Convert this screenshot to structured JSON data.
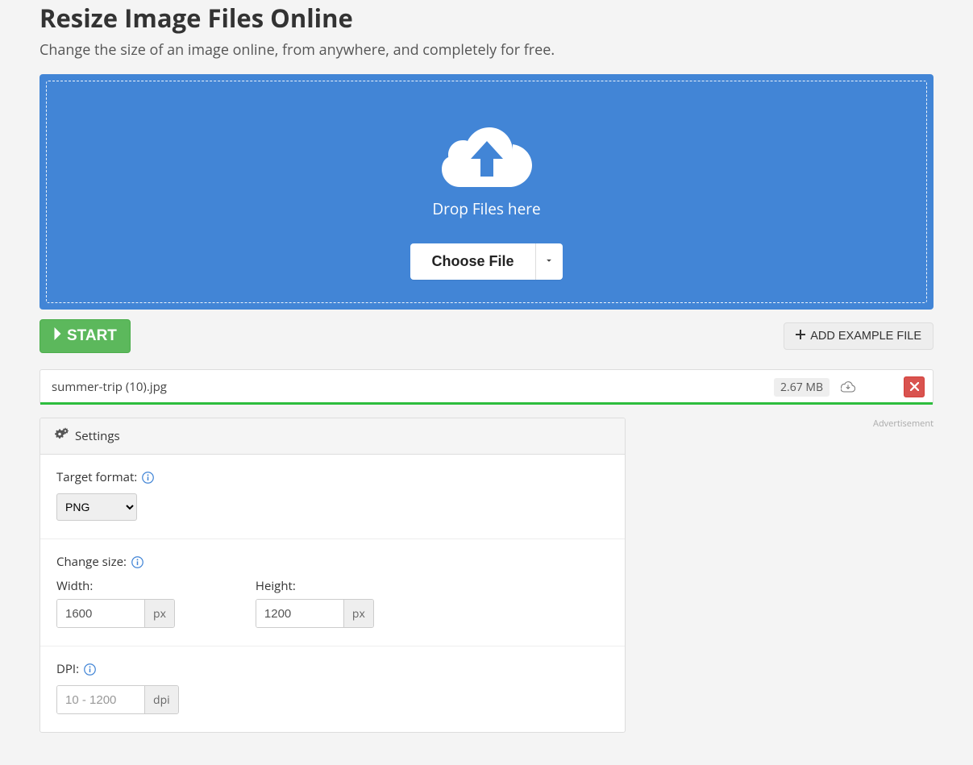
{
  "page": {
    "title": "Resize Image Files Online",
    "subtitle": "Change the size of an image online, from anywhere, and completely for free."
  },
  "dropzone": {
    "label": "Drop Files here",
    "choose_label": "Choose File"
  },
  "actions": {
    "start_label": "START",
    "add_example_label": "ADD EXAMPLE FILE"
  },
  "file": {
    "name": "summer-trip (10).jpg",
    "size": "2.67 MB"
  },
  "settings": {
    "heading": "Settings",
    "target_format": {
      "label": "Target format:",
      "value": "PNG"
    },
    "change_size": {
      "label": "Change size:",
      "width_label": "Width:",
      "height_label": "Height:",
      "width_value": "1600",
      "height_value": "1200",
      "unit": "px"
    },
    "dpi": {
      "label": "DPI:",
      "placeholder": "10 - 1200",
      "unit": "dpi"
    }
  },
  "ad": {
    "label": "Advertisement"
  }
}
